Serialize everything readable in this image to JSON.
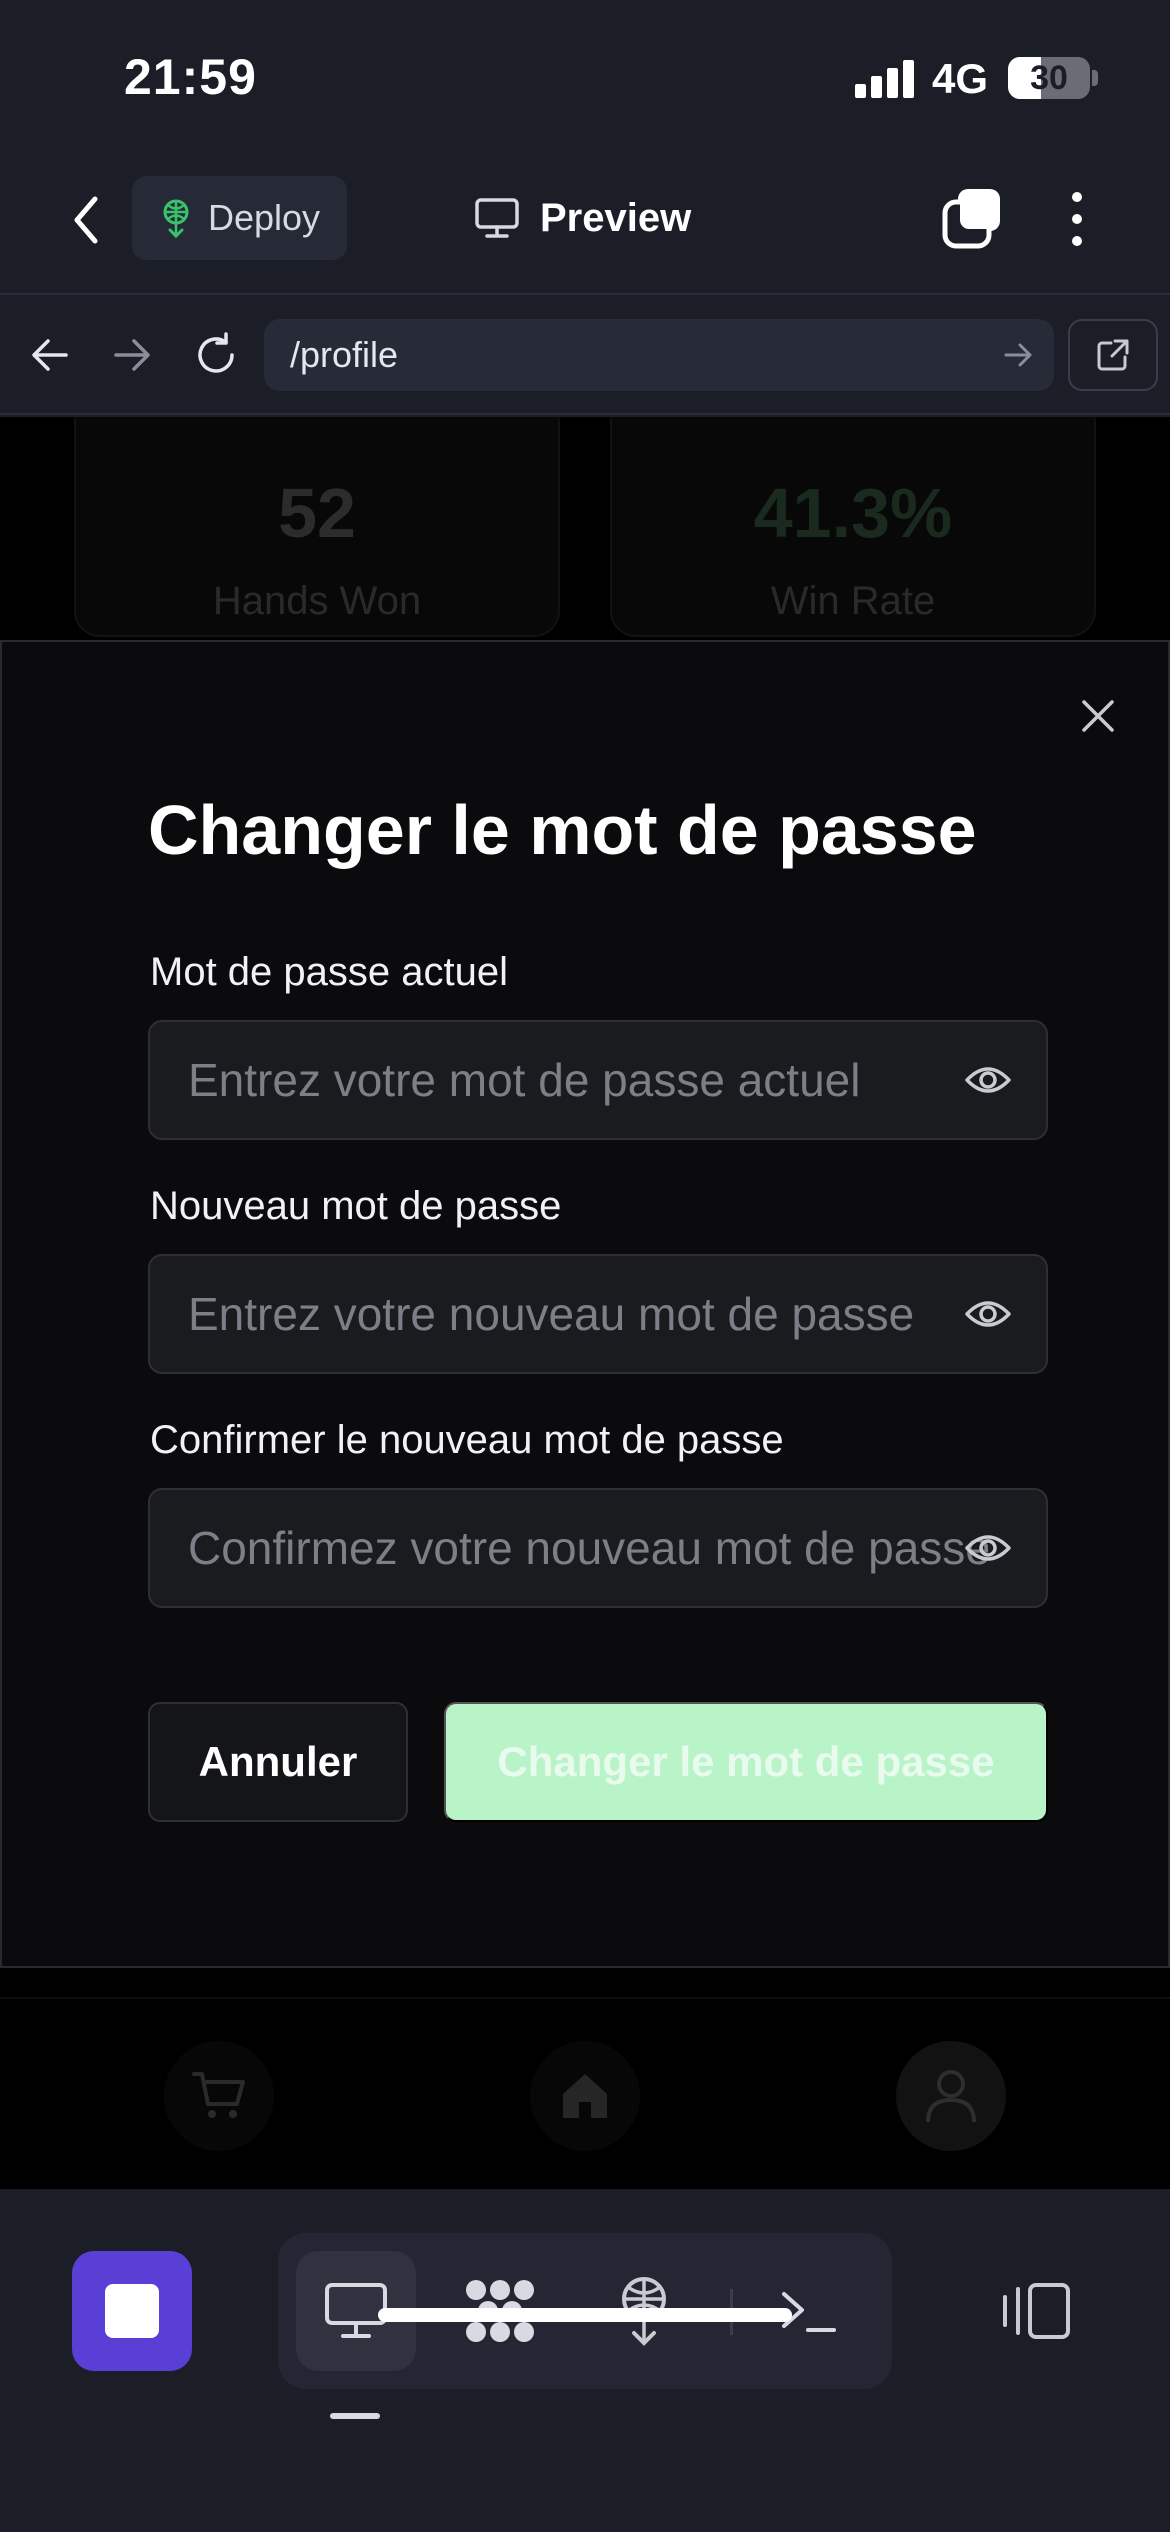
{
  "status_bar": {
    "time": "21:59",
    "network": "4G",
    "battery": "30",
    "battery_level": 0.3
  },
  "app_bar": {
    "deploy_label": "Deploy",
    "preview_label": "Preview"
  },
  "browser": {
    "url": "/profile"
  },
  "page": {
    "stats": [
      {
        "value": "52",
        "label": "Hands Won",
        "color": "#2c2c2c"
      },
      {
        "value": "41.3%",
        "label": "Win Rate",
        "color": "#1a2a1e"
      }
    ]
  },
  "modal": {
    "title": "Changer le mot de passe",
    "fields": [
      {
        "label": "Mot de passe actuel",
        "placeholder": "Entrez votre mot de passe actuel"
      },
      {
        "label": "Nouveau mot de passe",
        "placeholder": "Entrez votre nouveau mot de passe"
      },
      {
        "label": "Confirmer le nouveau mot de passe",
        "placeholder": "Confirmez votre nouveau mot de passe"
      }
    ],
    "cancel_label": "Annuler",
    "submit_label": "Changer le mot de passe",
    "accent_color": "#b8f4c8"
  },
  "toolbar": {
    "stop_color": "#5a3fd6",
    "tools": [
      "monitor-icon",
      "apps-icon",
      "deploy-icon",
      "terminal-icon"
    ],
    "active_tool": "monitor-icon"
  }
}
